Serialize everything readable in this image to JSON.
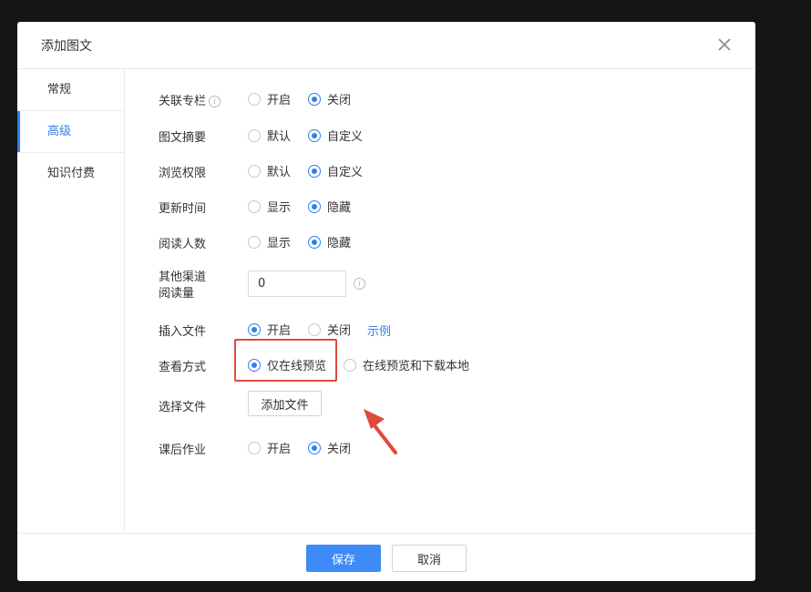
{
  "dialog": {
    "title": "添加图文",
    "close_icon": "close-icon"
  },
  "sidebar": {
    "tabs": [
      {
        "label": "常规",
        "active": false
      },
      {
        "label": "高级",
        "active": true
      },
      {
        "label": "知识付费",
        "active": false
      }
    ]
  },
  "form": {
    "column": {
      "label": "关联专栏",
      "options": [
        "开启",
        "关闭"
      ],
      "selected": "关闭",
      "info_icon": "info-icon"
    },
    "summary": {
      "label": "图文摘要",
      "options": [
        "默认",
        "自定义"
      ],
      "selected": "自定义"
    },
    "permission": {
      "label": "浏览权限",
      "options": [
        "默认",
        "自定义"
      ],
      "selected": "自定义"
    },
    "update_time": {
      "label": "更新时间",
      "options": [
        "显示",
        "隐藏"
      ],
      "selected": "隐藏"
    },
    "readers": {
      "label": "阅读人数",
      "options": [
        "显示",
        "隐藏"
      ],
      "selected": "隐藏"
    },
    "other_reads": {
      "label_line1": "其他渠道",
      "label_line2": "阅读量",
      "value": "0",
      "info_icon": "info-icon"
    },
    "insert_file": {
      "label": "插入文件",
      "options": [
        "开启",
        "关闭"
      ],
      "selected": "开启",
      "example_link": "示例"
    },
    "view_mode": {
      "label": "查看方式",
      "options": [
        "仅在线预览",
        "在线预览和下载本地"
      ],
      "selected": "仅在线预览"
    },
    "choose_file": {
      "label": "选择文件",
      "button": "添加文件"
    },
    "homework": {
      "label": "课后作业",
      "options": [
        "开启",
        "关闭"
      ],
      "selected": "关闭"
    }
  },
  "footer": {
    "save": "保存",
    "cancel": "取消"
  },
  "colors": {
    "accent": "#2f80ed",
    "primary_button": "#3e8bf7",
    "annotation_red": "#e04a3b"
  }
}
